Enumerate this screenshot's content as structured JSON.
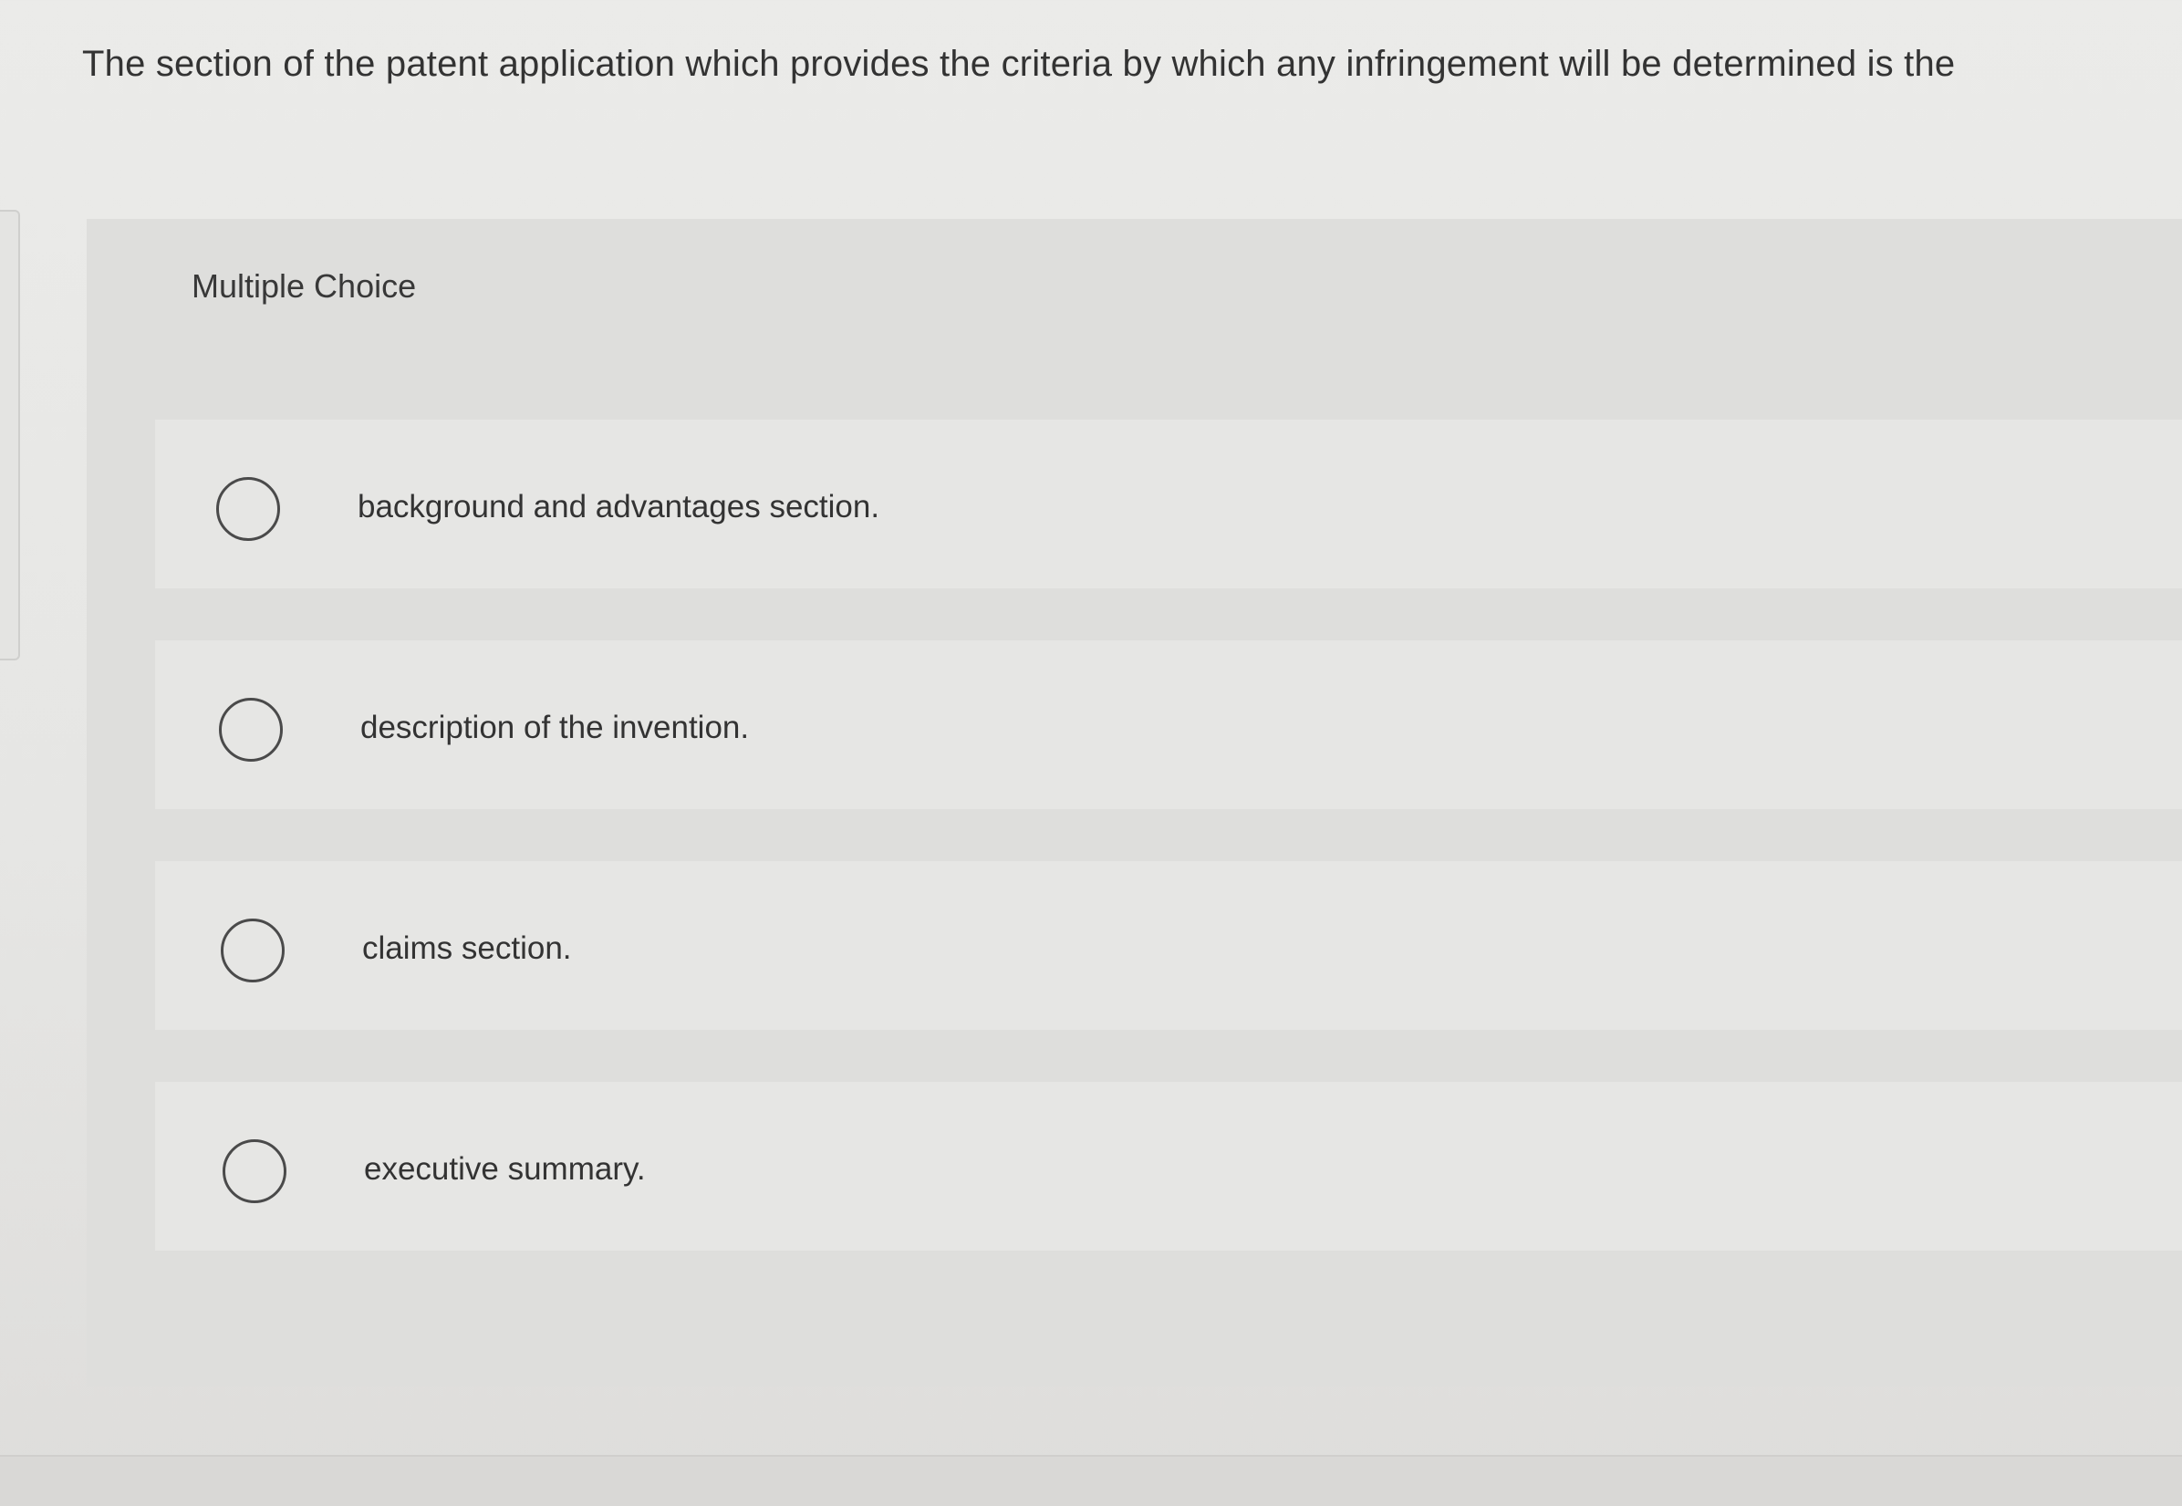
{
  "question": {
    "text": "The section of the patent application which provides the criteria by which any infringement will be determined is the"
  },
  "multiple_choice": {
    "label": "Multiple Choice",
    "options": [
      {
        "text": "background and advantages section.",
        "selected": false
      },
      {
        "text": "description of the invention.",
        "selected": false
      },
      {
        "text": "claims section.",
        "selected": false
      },
      {
        "text": "executive summary.",
        "selected": false
      }
    ]
  },
  "colors": {
    "page_background": "#e8e8e6",
    "panel_background": "#dededc",
    "option_background": "#e6e6e4",
    "text": "#333333",
    "radio_border": "#4a4a4a"
  }
}
